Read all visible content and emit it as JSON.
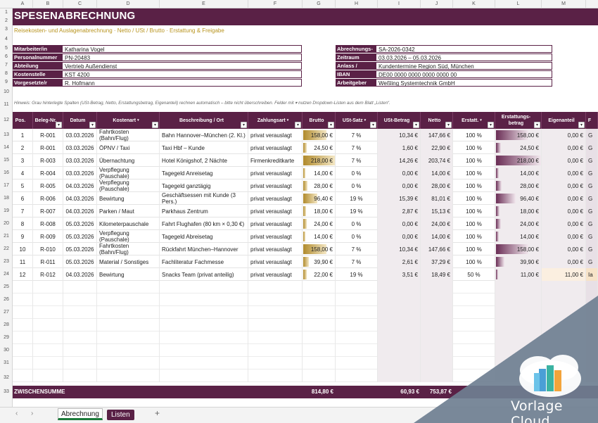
{
  "columns": [
    "A",
    "B",
    "C",
    "D",
    "E",
    "F",
    "G",
    "H",
    "I",
    "J",
    "K",
    "L",
    "M"
  ],
  "rows": [
    "1",
    "2",
    "3",
    "4",
    "5",
    "6",
    "7",
    "8",
    "9",
    "10",
    "11",
    "12",
    "13",
    "14",
    "15",
    "16",
    "17",
    "18",
    "19",
    "20",
    "21",
    "22",
    "23",
    "24",
    "25",
    "26",
    "27",
    "28",
    "29",
    "30",
    "31",
    "32",
    "33"
  ],
  "title": "SPESENABRECHNUNG",
  "subtitle": "Reisekosten- und Auslagenabrechnung  ·  Netto / USt / Brutto  ·  Erstattung & Freigabe",
  "info_left": [
    {
      "label": "Mitarbeiter/in",
      "value": "Katharina Vogel"
    },
    {
      "label": "Personalnummer",
      "value": "PN-20483"
    },
    {
      "label": "Abteilung",
      "value": "Vertrieb Außendienst"
    },
    {
      "label": "Kostenstelle",
      "value": "KST 4200"
    },
    {
      "label": "Vorgesetzte/r",
      "value": "R. Hofmann"
    }
  ],
  "info_right": [
    {
      "label": "Abrechnungs-Nr.",
      "value": "SA-2026-0342"
    },
    {
      "label": "Zeitraum",
      "value": "03.03.2026 – 05.03.2026"
    },
    {
      "label": "Anlass / Reiseziel",
      "value": "Kundentermine Region Süd, München"
    },
    {
      "label": "IBAN (Erstattung)",
      "value": "DE00 0000 0000 0000 0000 00"
    },
    {
      "label": "Arbeitgeber",
      "value": "Weßling Systemtechnik GmbH"
    }
  ],
  "hint": "Hinweis: Grau hinterlegte Spalten (USt-Betrag, Netto, Erstattungsbetrag, Eigenanteil) rechnen automatisch – bitte nicht überschreiben. Felder mit ▾ nutzen Dropdown-Listen aus dem Blatt „Listen“.",
  "headers": {
    "pos": "Pos.",
    "beleg": "Beleg-Nr.",
    "datum": "Datum",
    "kostenart": "Kostenart",
    "beschreibung": "Beschreibung / Ort",
    "zahlungsart": "Zahlungsart",
    "brutto": "Brutto",
    "ust_satz": "USt-Satz",
    "ust_betrag": "USt-Betrag",
    "netto": "Netto",
    "erstatt": "Erstatt.",
    "erstattungsbetrag": "Erstattungs-betrag",
    "eigenanteil": "Eigenanteil",
    "extra": "F"
  },
  "dropdown_glyph": "▾",
  "table": [
    {
      "pos": "1",
      "beleg": "R-001",
      "datum": "03.03.2026",
      "kostenart": "Fahrtkosten (Bahn/Flug)",
      "beschreibung": "Bahn Hannover–München (2. Kl.)",
      "zahlungsart": "privat verauslagt",
      "brutto": "158,00 €",
      "brutto_val": 158,
      "ust_satz": "7 %",
      "ust_betrag": "10,34 €",
      "netto": "147,66 €",
      "erstatt": "100 %",
      "erstattungsbetrag": "158,00 €",
      "erstattung_val": 158,
      "eigenanteil": "0,00 €",
      "extra": "G"
    },
    {
      "pos": "2",
      "beleg": "R-001",
      "datum": "03.03.2026",
      "kostenart": "ÖPNV / Taxi",
      "beschreibung": "Taxi Hbf – Kunde",
      "zahlungsart": "privat verauslagt",
      "brutto": "24,50 €",
      "brutto_val": 24.5,
      "ust_satz": "7 %",
      "ust_betrag": "1,60 €",
      "netto": "22,90 €",
      "erstatt": "100 %",
      "erstattungsbetrag": "24,50 €",
      "erstattung_val": 24.5,
      "eigenanteil": "0,00 €",
      "extra": "G"
    },
    {
      "pos": "3",
      "beleg": "R-003",
      "datum": "03.03.2026",
      "kostenart": "Übernachtung",
      "beschreibung": "Hotel Königshof, 2 Nächte",
      "zahlungsart": "Firmenkreditkarte",
      "brutto": "218,00 €",
      "brutto_val": 218,
      "ust_satz": "7 %",
      "ust_betrag": "14,26 €",
      "netto": "203,74 €",
      "erstatt": "100 %",
      "erstattungsbetrag": "218,00 €",
      "erstattung_val": 218,
      "eigenanteil": "0,00 €",
      "extra": "G"
    },
    {
      "pos": "4",
      "beleg": "R-004",
      "datum": "03.03.2026",
      "kostenart": "Verpflegung (Pauschale)",
      "beschreibung": "Tagegeld Anreisetag",
      "zahlungsart": "privat verauslagt",
      "brutto": "14,00 €",
      "brutto_val": 14,
      "ust_satz": "0 %",
      "ust_betrag": "0,00 €",
      "netto": "14,00 €",
      "erstatt": "100 %",
      "erstattungsbetrag": "14,00 €",
      "erstattung_val": 14,
      "eigenanteil": "0,00 €",
      "extra": "G"
    },
    {
      "pos": "5",
      "beleg": "R-005",
      "datum": "04.03.2026",
      "kostenart": "Verpflegung (Pauschale)",
      "beschreibung": "Tagegeld ganztägig",
      "zahlungsart": "privat verauslagt",
      "brutto": "28,00 €",
      "brutto_val": 28,
      "ust_satz": "0 %",
      "ust_betrag": "0,00 €",
      "netto": "28,00 €",
      "erstatt": "100 %",
      "erstattungsbetrag": "28,00 €",
      "erstattung_val": 28,
      "eigenanteil": "0,00 €",
      "extra": "G"
    },
    {
      "pos": "6",
      "beleg": "R-006",
      "datum": "04.03.2026",
      "kostenart": "Bewirtung",
      "beschreibung": "Geschäftsessen mit Kunde (3 Pers.)",
      "zahlungsart": "privat verauslagt",
      "brutto": "96,40 €",
      "brutto_val": 96.4,
      "ust_satz": "19 %",
      "ust_betrag": "15,39 €",
      "netto": "81,01 €",
      "erstatt": "100 %",
      "erstattungsbetrag": "96,40 €",
      "erstattung_val": 96.4,
      "eigenanteil": "0,00 €",
      "extra": "G"
    },
    {
      "pos": "7",
      "beleg": "R-007",
      "datum": "04.03.2026",
      "kostenart": "Parken / Maut",
      "beschreibung": "Parkhaus Zentrum",
      "zahlungsart": "privat verauslagt",
      "brutto": "18,00 €",
      "brutto_val": 18,
      "ust_satz": "19 %",
      "ust_betrag": "2,87 €",
      "netto": "15,13 €",
      "erstatt": "100 %",
      "erstattungsbetrag": "18,00 €",
      "erstattung_val": 18,
      "eigenanteil": "0,00 €",
      "extra": "G"
    },
    {
      "pos": "8",
      "beleg": "R-008",
      "datum": "05.03.2026",
      "kostenart": "Kilometerpauschale",
      "beschreibung": "Fahrt Flughafen (80 km × 0,30 €)",
      "zahlungsart": "privat verauslagt",
      "brutto": "24,00 €",
      "brutto_val": 24,
      "ust_satz": "0 %",
      "ust_betrag": "0,00 €",
      "netto": "24,00 €",
      "erstatt": "100 %",
      "erstattungsbetrag": "24,00 €",
      "erstattung_val": 24,
      "eigenanteil": "0,00 €",
      "extra": "G"
    },
    {
      "pos": "9",
      "beleg": "R-009",
      "datum": "05.03.2026",
      "kostenart": "Verpflegung (Pauschale)",
      "beschreibung": "Tagegeld Abreisetag",
      "zahlungsart": "privat verauslagt",
      "brutto": "14,00 €",
      "brutto_val": 14,
      "ust_satz": "0 %",
      "ust_betrag": "0,00 €",
      "netto": "14,00 €",
      "erstatt": "100 %",
      "erstattungsbetrag": "14,00 €",
      "erstattung_val": 14,
      "eigenanteil": "0,00 €",
      "extra": "G"
    },
    {
      "pos": "10",
      "beleg": "R-010",
      "datum": "05.03.2026",
      "kostenart": "Fahrtkosten (Bahn/Flug)",
      "beschreibung": "Rückfahrt München–Hannover",
      "zahlungsart": "privat verauslagt",
      "brutto": "158,00 €",
      "brutto_val": 158,
      "ust_satz": "7 %",
      "ust_betrag": "10,34 €",
      "netto": "147,66 €",
      "erstatt": "100 %",
      "erstattungsbetrag": "158,00 €",
      "erstattung_val": 158,
      "eigenanteil": "0,00 €",
      "extra": "G"
    },
    {
      "pos": "11",
      "beleg": "R-011",
      "datum": "05.03.2026",
      "kostenart": "Material / Sonstiges",
      "beschreibung": "Fachliteratur Fachmesse",
      "zahlungsart": "privat verauslagt",
      "brutto": "39,90 €",
      "brutto_val": 39.9,
      "ust_satz": "7 %",
      "ust_betrag": "2,61 €",
      "netto": "37,29 €",
      "erstatt": "100 %",
      "erstattungsbetrag": "39,90 €",
      "erstattung_val": 39.9,
      "eigenanteil": "0,00 €",
      "extra": "G"
    },
    {
      "pos": "12",
      "beleg": "R-012",
      "datum": "04.03.2026",
      "kostenart": "Bewirtung",
      "beschreibung": "Snacks Team (privat anteilig)",
      "zahlungsart": "privat verauslagt",
      "brutto": "22,00 €",
      "brutto_val": 22,
      "ust_satz": "19 %",
      "ust_betrag": "3,51 €",
      "netto": "18,49 €",
      "erstatt": "50 %",
      "erstattungsbetrag": "11,00 €",
      "erstattung_val": 11,
      "eigenanteil": "11,00 €",
      "extra": "Ia"
    }
  ],
  "bar_max": 218,
  "summary": {
    "label": "ZWISCHENSUMME",
    "brutto": "814,80 €",
    "ust_betrag": "60,93 €",
    "netto": "753,87 €"
  },
  "tabs": {
    "active": "Abrechnung",
    "second": "Listen",
    "add": "+",
    "prev": "‹",
    "next": "›"
  },
  "watermark": "Vorlage Cloud",
  "colors": {
    "brand": "#5a2146",
    "gold": "#b8941f",
    "tab_active": "#1d7a3b"
  }
}
